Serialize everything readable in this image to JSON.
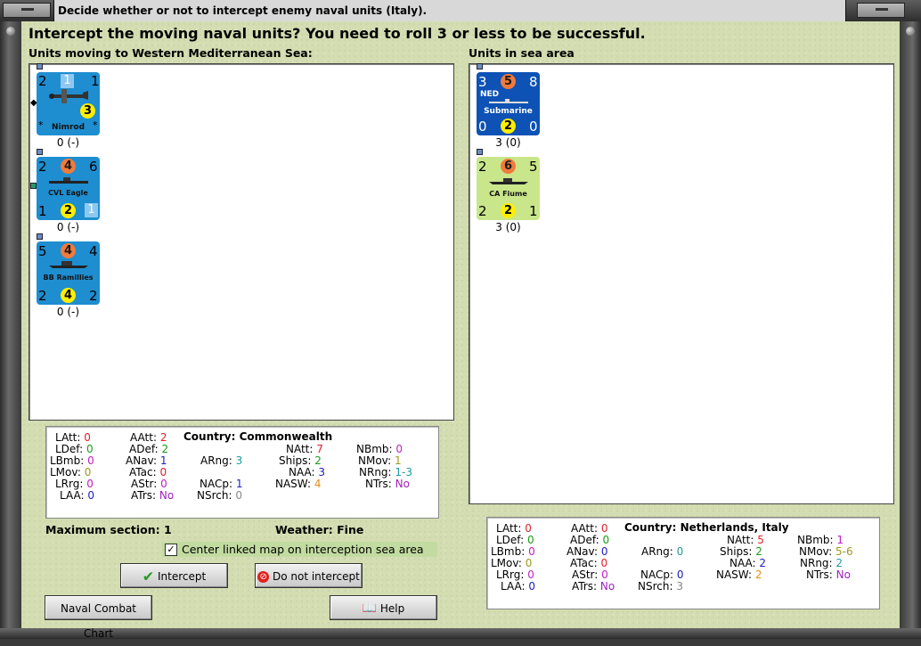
{
  "window": {
    "title": "Decide whether or not to intercept enemy naval units (Italy)."
  },
  "headline": "Intercept the moving naval units?  You need to roll 3 or less to be successful.",
  "moving_units": {
    "label": "Units moving to Western Mediterranean Sea:",
    "items": [
      {
        "name": "Nimrod",
        "tl": "2",
        "tc": "1",
        "tr": "1",
        "circle": "3",
        "star_l": "*",
        "star_r": "*",
        "status": "0 (-)"
      },
      {
        "name": "CVL Eagle",
        "tl": "2",
        "tc": "4",
        "tr": "6",
        "bl": "1",
        "bc": "2",
        "br": "1",
        "status": "0 (-)"
      },
      {
        "name": "BB Ramillies",
        "tl": "5",
        "tc": "4",
        "tr": "4",
        "bl": "2",
        "bc": "4",
        "br": "2",
        "status": "0 (-)"
      }
    ]
  },
  "sea_units": {
    "label": "Units in sea area",
    "items": [
      {
        "name": "Submarine",
        "tag": "NED",
        "tl": "3",
        "tc": "5",
        "tr": "8",
        "bl": "0",
        "bc": "2",
        "br": "0",
        "status": "3 (0)"
      },
      {
        "name": "CA Fiume",
        "tl": "2",
        "tc": "6",
        "tr": "5",
        "bl": "2",
        "bc": "2",
        "br": "1",
        "status": "3 (0)"
      }
    ]
  },
  "stats_left": {
    "country_label": "Country:",
    "country": "Commonwealth",
    "LAtt": "0",
    "LDef": "0",
    "LBmb": "0",
    "LMov": "0",
    "LRrg": "0",
    "LAA": "0",
    "AAtt": "2",
    "ADef": "2",
    "ANav": "1",
    "ATac": "0",
    "AStr": "0",
    "ATrs": "No",
    "ARng": "3",
    "NACp": "1",
    "NSrch": "0",
    "NAtt": "7",
    "Ships": "2",
    "NAA": "3",
    "NASW": "4",
    "NBmb": "0",
    "NMov": "1",
    "NRng": "1-3",
    "NTrs": "No"
  },
  "stats_right": {
    "country_label": "Country:",
    "country": "Netherlands, Italy",
    "LAtt": "0",
    "LDef": "0",
    "LBmb": "0",
    "LMov": "0",
    "LRrg": "0",
    "LAA": "0",
    "AAtt": "0",
    "ADef": "0",
    "ANav": "0",
    "ATac": "0",
    "AStr": "0",
    "ATrs": "No",
    "ARng": "0",
    "NACp": "0",
    "NSrch": "3",
    "NAtt": "5",
    "Ships": "2",
    "NAA": "2",
    "NASW": "2",
    "NBmb": "1",
    "NMov": "5-6",
    "NRng": "2",
    "NTrs": "No"
  },
  "max_section": "Maximum section: 1",
  "weather": "Weather:  Fine",
  "center_map_label": "Center linked map on interception sea area",
  "center_map_checked": "✓",
  "buttons": {
    "intercept": "Intercept",
    "do_not_intercept": "Do not intercept",
    "naval_chart": "Naval Combat Chart",
    "help": "Help"
  },
  "colors": {
    "panel_bg": "#d3ddb1",
    "unit_blue": "#1e8ed0",
    "unit_dark_blue": "#0d52b4",
    "unit_green": "#c9e68a"
  }
}
